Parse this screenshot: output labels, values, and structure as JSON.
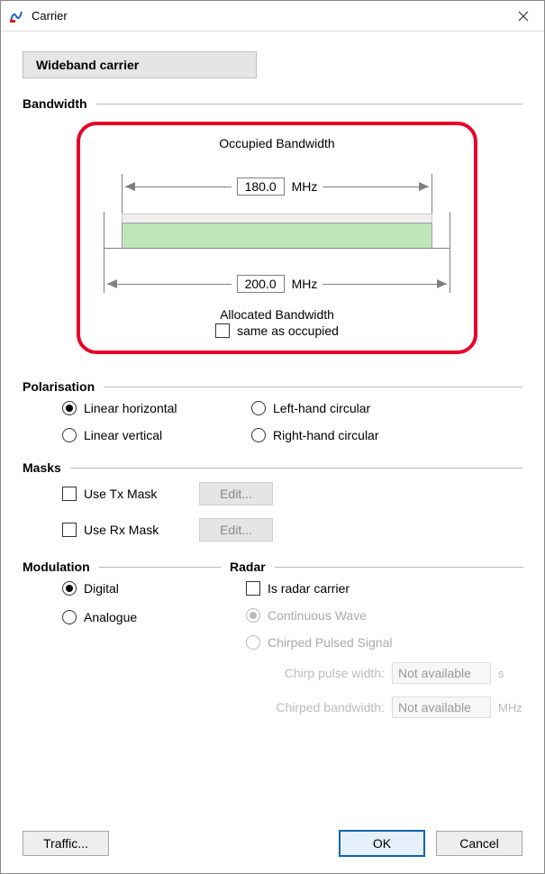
{
  "window": {
    "title": "Carrier"
  },
  "tab": {
    "label": "Wideband carrier"
  },
  "bandwidth": {
    "section": "Bandwidth",
    "occupied_label": "Occupied Bandwidth",
    "occupied_value": "180.0",
    "occupied_unit": "MHz",
    "allocated_label": "Allocated Bandwidth",
    "allocated_value": "200.0",
    "allocated_unit": "MHz",
    "same_as_occupied": "same as occupied"
  },
  "polarisation": {
    "section": "Polarisation",
    "linear_h": "Linear horizontal",
    "linear_v": "Linear vertical",
    "left_circ": "Left-hand circular",
    "right_circ": "Right-hand circular"
  },
  "masks": {
    "section": "Masks",
    "use_tx": "Use Tx Mask",
    "use_rx": "Use Rx Mask",
    "edit": "Edit..."
  },
  "modulation": {
    "section": "Modulation",
    "digital": "Digital",
    "analogue": "Analogue"
  },
  "radar": {
    "section": "Radar",
    "is_radar": "Is radar carrier",
    "cw": "Continuous Wave",
    "chirped": "Chirped Pulsed Signal",
    "pulse_width_label": "Chirp pulse width:",
    "pulse_width_value": "Not available",
    "pulse_width_unit": "s",
    "bandwidth_label": "Chirped bandwidth:",
    "bandwidth_value": "Not available",
    "bandwidth_unit": "MHz"
  },
  "buttons": {
    "traffic": "Traffic...",
    "ok": "OK",
    "cancel": "Cancel"
  }
}
